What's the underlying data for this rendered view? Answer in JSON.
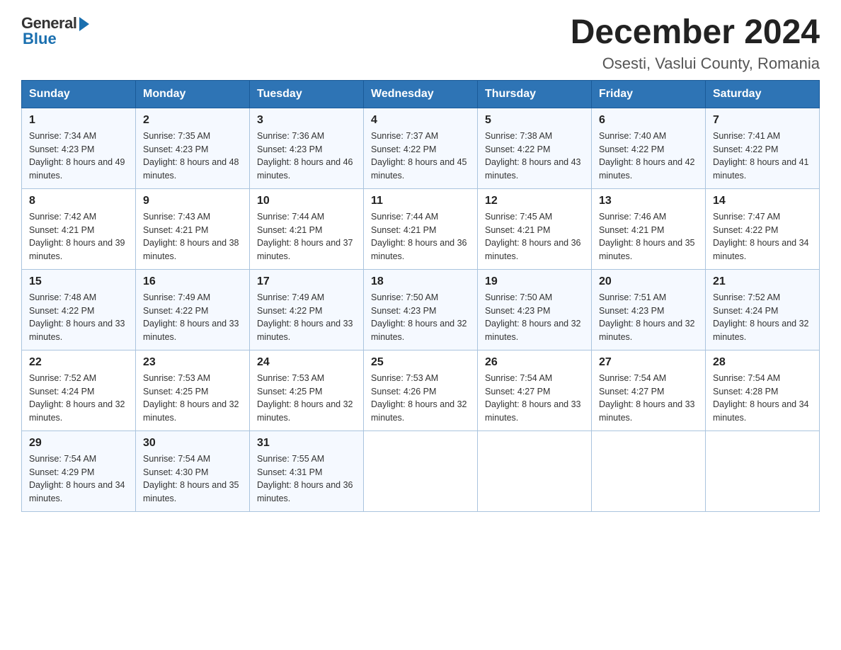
{
  "header": {
    "title": "December 2024",
    "subtitle": "Osesti, Vaslui County, Romania"
  },
  "logo": {
    "general": "General",
    "blue": "Blue"
  },
  "days": [
    "Sunday",
    "Monday",
    "Tuesday",
    "Wednesday",
    "Thursday",
    "Friday",
    "Saturday"
  ],
  "weeks": [
    [
      {
        "day": "1",
        "sunrise": "7:34 AM",
        "sunset": "4:23 PM",
        "daylight": "8 hours and 49 minutes."
      },
      {
        "day": "2",
        "sunrise": "7:35 AM",
        "sunset": "4:23 PM",
        "daylight": "8 hours and 48 minutes."
      },
      {
        "day": "3",
        "sunrise": "7:36 AM",
        "sunset": "4:23 PM",
        "daylight": "8 hours and 46 minutes."
      },
      {
        "day": "4",
        "sunrise": "7:37 AM",
        "sunset": "4:22 PM",
        "daylight": "8 hours and 45 minutes."
      },
      {
        "day": "5",
        "sunrise": "7:38 AM",
        "sunset": "4:22 PM",
        "daylight": "8 hours and 43 minutes."
      },
      {
        "day": "6",
        "sunrise": "7:40 AM",
        "sunset": "4:22 PM",
        "daylight": "8 hours and 42 minutes."
      },
      {
        "day": "7",
        "sunrise": "7:41 AM",
        "sunset": "4:22 PM",
        "daylight": "8 hours and 41 minutes."
      }
    ],
    [
      {
        "day": "8",
        "sunrise": "7:42 AM",
        "sunset": "4:21 PM",
        "daylight": "8 hours and 39 minutes."
      },
      {
        "day": "9",
        "sunrise": "7:43 AM",
        "sunset": "4:21 PM",
        "daylight": "8 hours and 38 minutes."
      },
      {
        "day": "10",
        "sunrise": "7:44 AM",
        "sunset": "4:21 PM",
        "daylight": "8 hours and 37 minutes."
      },
      {
        "day": "11",
        "sunrise": "7:44 AM",
        "sunset": "4:21 PM",
        "daylight": "8 hours and 36 minutes."
      },
      {
        "day": "12",
        "sunrise": "7:45 AM",
        "sunset": "4:21 PM",
        "daylight": "8 hours and 36 minutes."
      },
      {
        "day": "13",
        "sunrise": "7:46 AM",
        "sunset": "4:21 PM",
        "daylight": "8 hours and 35 minutes."
      },
      {
        "day": "14",
        "sunrise": "7:47 AM",
        "sunset": "4:22 PM",
        "daylight": "8 hours and 34 minutes."
      }
    ],
    [
      {
        "day": "15",
        "sunrise": "7:48 AM",
        "sunset": "4:22 PM",
        "daylight": "8 hours and 33 minutes."
      },
      {
        "day": "16",
        "sunrise": "7:49 AM",
        "sunset": "4:22 PM",
        "daylight": "8 hours and 33 minutes."
      },
      {
        "day": "17",
        "sunrise": "7:49 AM",
        "sunset": "4:22 PM",
        "daylight": "8 hours and 33 minutes."
      },
      {
        "day": "18",
        "sunrise": "7:50 AM",
        "sunset": "4:23 PM",
        "daylight": "8 hours and 32 minutes."
      },
      {
        "day": "19",
        "sunrise": "7:50 AM",
        "sunset": "4:23 PM",
        "daylight": "8 hours and 32 minutes."
      },
      {
        "day": "20",
        "sunrise": "7:51 AM",
        "sunset": "4:23 PM",
        "daylight": "8 hours and 32 minutes."
      },
      {
        "day": "21",
        "sunrise": "7:52 AM",
        "sunset": "4:24 PM",
        "daylight": "8 hours and 32 minutes."
      }
    ],
    [
      {
        "day": "22",
        "sunrise": "7:52 AM",
        "sunset": "4:24 PM",
        "daylight": "8 hours and 32 minutes."
      },
      {
        "day": "23",
        "sunrise": "7:53 AM",
        "sunset": "4:25 PM",
        "daylight": "8 hours and 32 minutes."
      },
      {
        "day": "24",
        "sunrise": "7:53 AM",
        "sunset": "4:25 PM",
        "daylight": "8 hours and 32 minutes."
      },
      {
        "day": "25",
        "sunrise": "7:53 AM",
        "sunset": "4:26 PM",
        "daylight": "8 hours and 32 minutes."
      },
      {
        "day": "26",
        "sunrise": "7:54 AM",
        "sunset": "4:27 PM",
        "daylight": "8 hours and 33 minutes."
      },
      {
        "day": "27",
        "sunrise": "7:54 AM",
        "sunset": "4:27 PM",
        "daylight": "8 hours and 33 minutes."
      },
      {
        "day": "28",
        "sunrise": "7:54 AM",
        "sunset": "4:28 PM",
        "daylight": "8 hours and 34 minutes."
      }
    ],
    [
      {
        "day": "29",
        "sunrise": "7:54 AM",
        "sunset": "4:29 PM",
        "daylight": "8 hours and 34 minutes."
      },
      {
        "day": "30",
        "sunrise": "7:54 AM",
        "sunset": "4:30 PM",
        "daylight": "8 hours and 35 minutes."
      },
      {
        "day": "31",
        "sunrise": "7:55 AM",
        "sunset": "4:31 PM",
        "daylight": "8 hours and 36 minutes."
      },
      null,
      null,
      null,
      null
    ]
  ]
}
